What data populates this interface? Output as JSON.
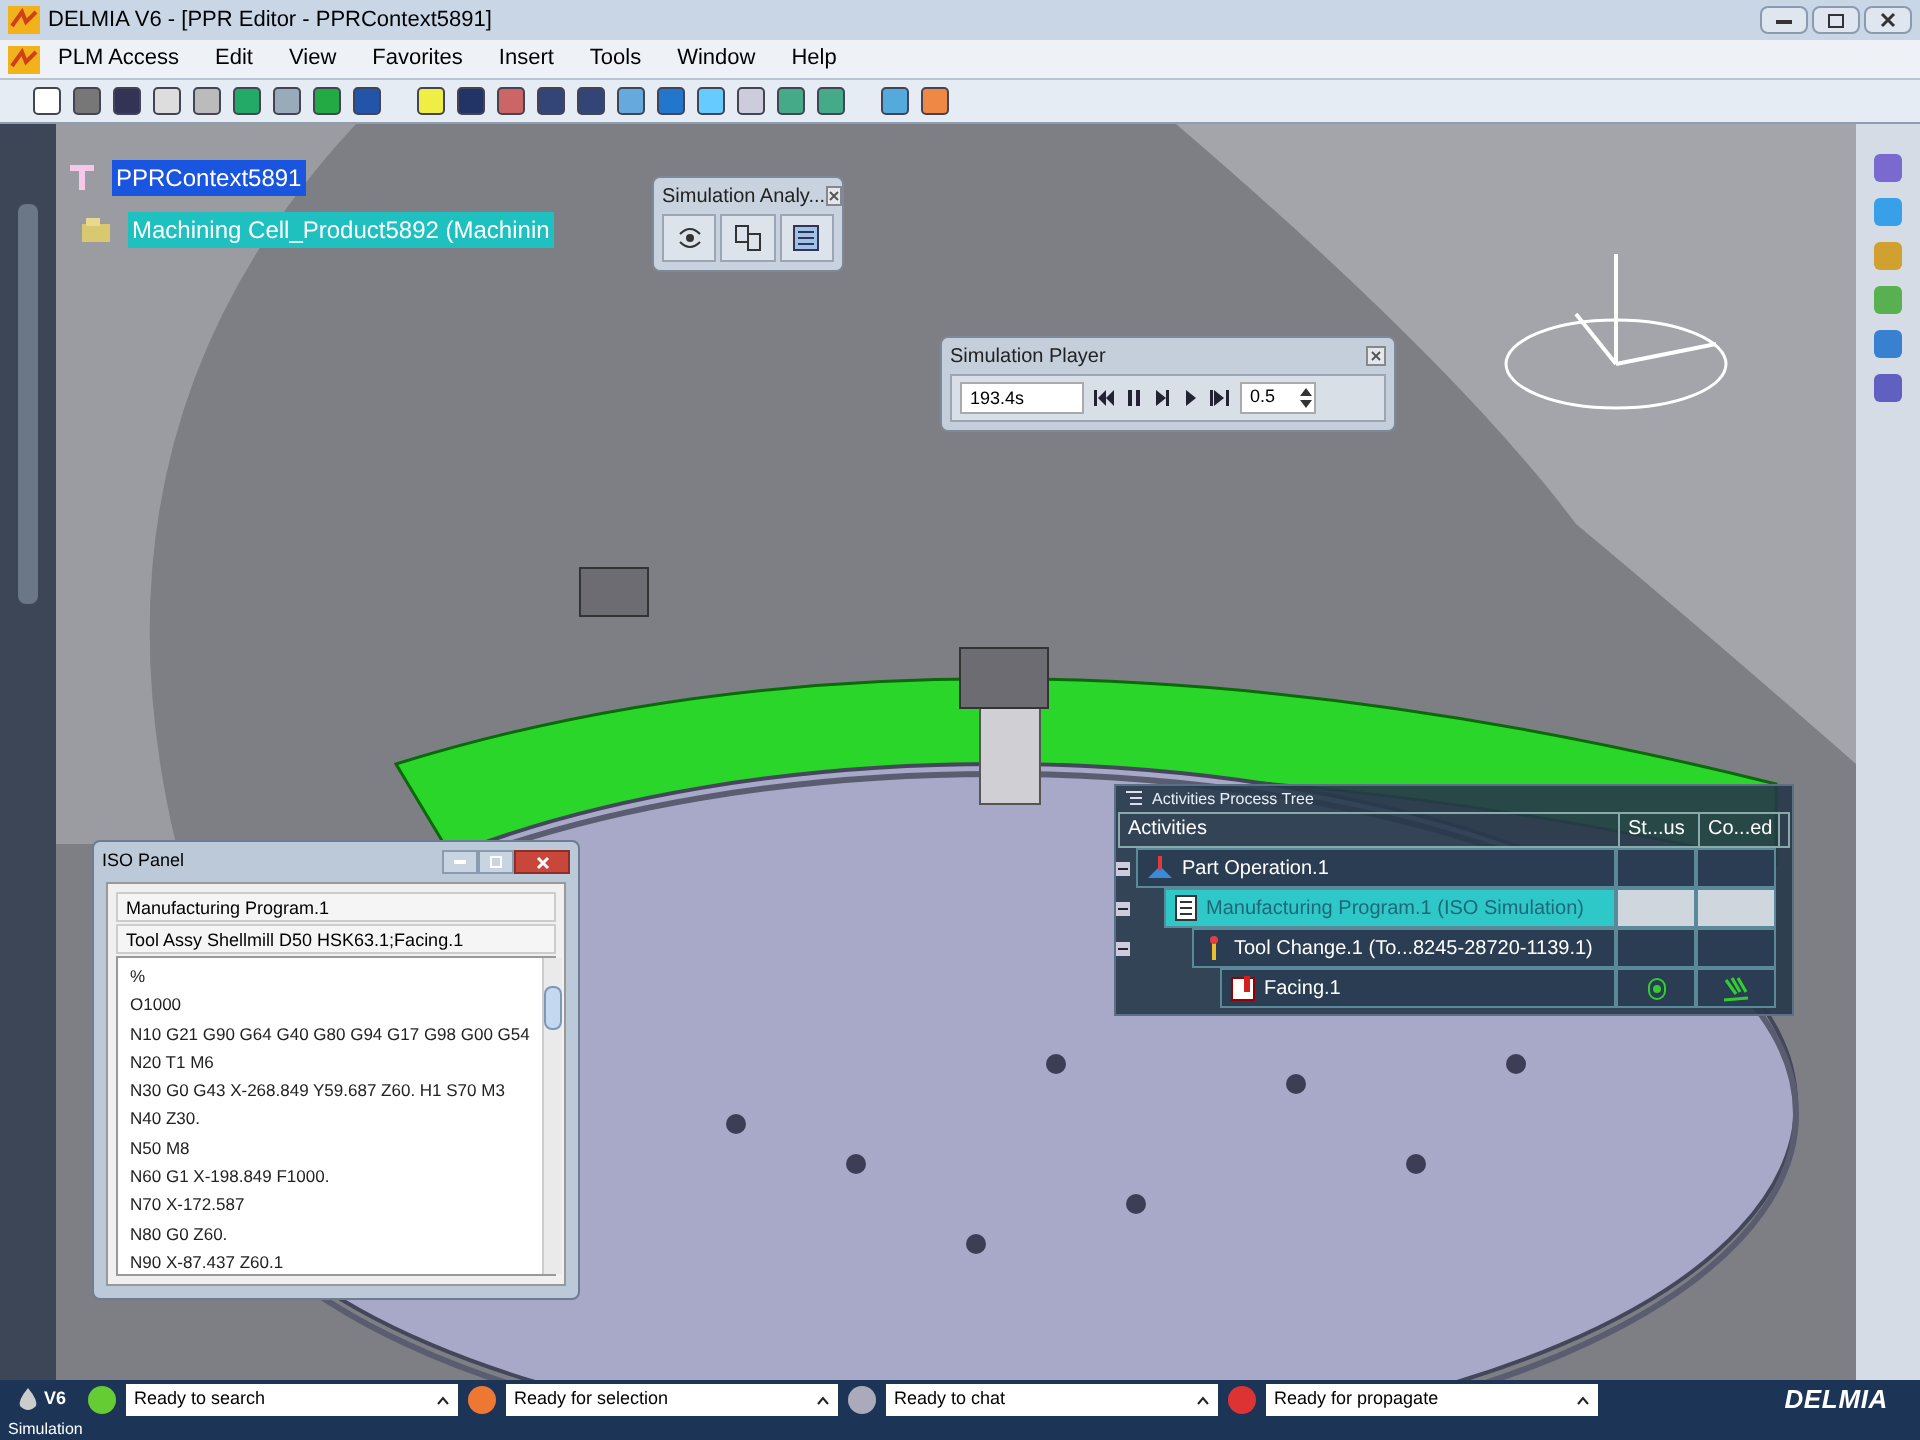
{
  "window": {
    "title": "DELMIA V6 - [PPR Editor - PPRContext5891]"
  },
  "menu": [
    "PLM Access",
    "Edit",
    "View",
    "Favorites",
    "Insert",
    "Tools",
    "Window",
    "Help"
  ],
  "tree": {
    "label": "PPRContext5891",
    "children": [
      {
        "label": "Machining Cell_Product5892 (Machinin"
      }
    ]
  },
  "simulation_analysis": {
    "title": "Simulation Analy..."
  },
  "simulation_player": {
    "title": "Simulation Player",
    "time": "193.4s",
    "speed": "0.5"
  },
  "iso_panel": {
    "title": "ISO Panel",
    "program": "Manufacturing Program.1",
    "tool": "Tool Assy Shellmill D50 HSK63.1;Facing.1",
    "lines": [
      "%",
      "O1000",
      "N10 G21 G90 G64 G40 G80 G94 G17 G98 G00 G54",
      "N20 T1 M6",
      "N30 G0 G43 X-268.849 Y59.687 Z60. H1 S70 M3",
      "N40 Z30.",
      "N50 M8",
      "N60 G1 X-198.849 F1000.",
      "N70 X-172.587",
      "N80 G0 Z60.",
      "N90 X-87.437 Z60.1"
    ]
  },
  "process_tree": {
    "title": "Activities Process Tree",
    "columns": [
      "Activities",
      "St...us",
      "Co...ed"
    ],
    "rows": [
      {
        "label": "Part Operation.1",
        "kind": "part_operation",
        "selected": false,
        "children": [
          {
            "label": "Manufacturing Program.1 (ISO Simulation)",
            "kind": "program",
            "selected": true,
            "children": [
              {
                "label": "Tool Change.1 (To...8245-28720-1139.1)",
                "kind": "tool_change",
                "selected": false,
                "children": [
                  {
                    "label": "Facing.1",
                    "kind": "operation",
                    "selected": false
                  }
                ]
              }
            ]
          }
        ]
      }
    ]
  },
  "status_bar": {
    "version": "V6",
    "fields": [
      "Ready to search",
      "Ready for selection",
      "Ready to chat",
      "Ready for propagate"
    ],
    "logo": "DELMIA",
    "message": "Simulation"
  }
}
